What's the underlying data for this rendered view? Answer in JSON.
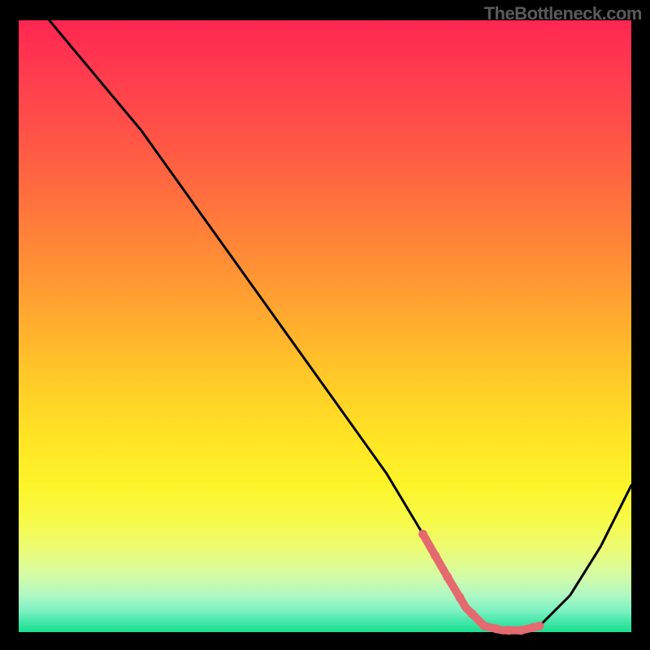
{
  "attribution": "TheBottleneck.com",
  "chart_data": {
    "type": "line",
    "title": "",
    "xlabel": "",
    "ylabel": "",
    "xlim": [
      0,
      100
    ],
    "ylim": [
      0,
      100
    ],
    "series": [
      {
        "name": "curve",
        "x": [
          5,
          10,
          20,
          30,
          40,
          50,
          60,
          66,
          70,
          73,
          76,
          79,
          82,
          85,
          90,
          95,
          100
        ],
        "y": [
          100,
          94,
          82,
          68,
          54,
          40,
          26,
          16,
          9,
          4,
          1,
          0.3,
          0.3,
          1,
          6,
          14,
          24
        ]
      }
    ],
    "flat_region": {
      "name": "minimum-band",
      "color": "#e46a6f",
      "x": [
        66,
        70,
        73,
        76,
        79,
        82,
        85
      ],
      "y": [
        16,
        9,
        4,
        1,
        0.3,
        0.3,
        1
      ]
    },
    "flat_points_x": [
      66,
      68,
      70,
      72,
      74,
      76,
      78,
      80,
      82,
      84,
      85
    ]
  }
}
